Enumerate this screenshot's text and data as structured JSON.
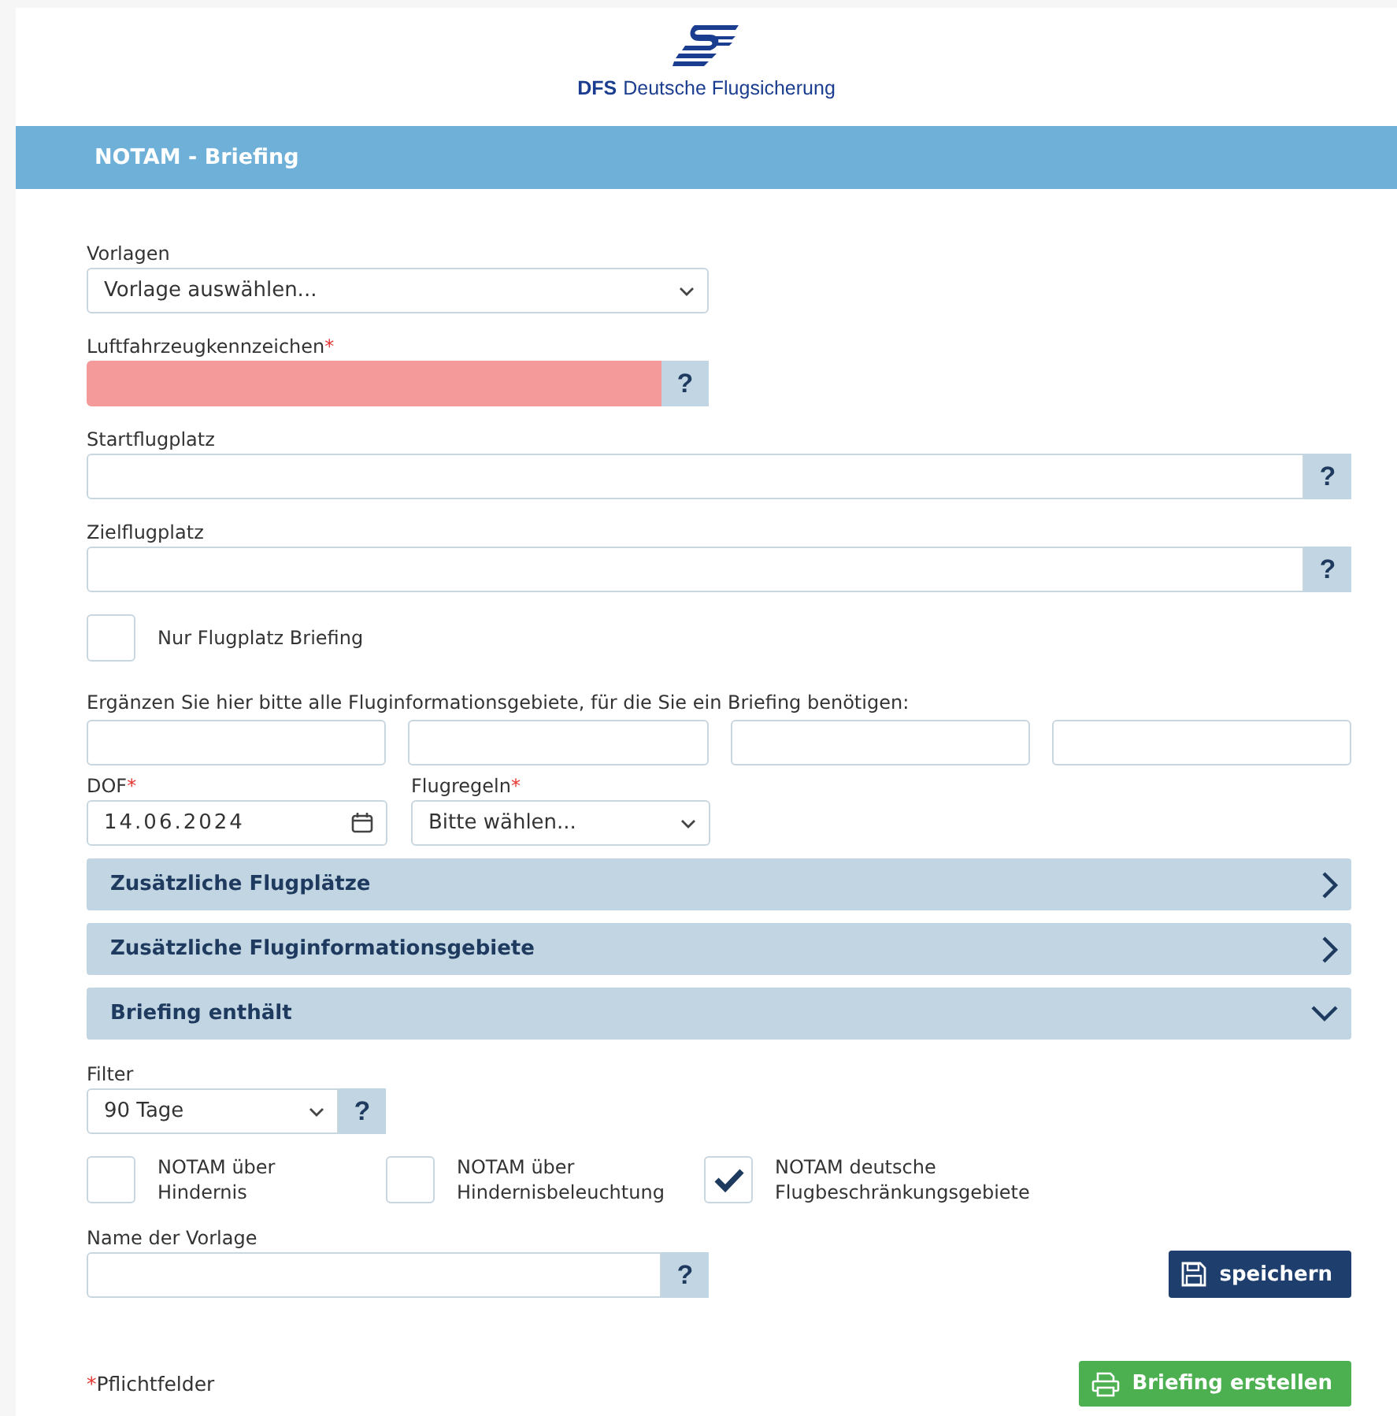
{
  "header": {
    "logo_abbr": "DFS",
    "logo_name": "Deutsche Flugsicherung"
  },
  "title_bar": "NOTAM - Briefing",
  "required_mark": "*",
  "template_select": {
    "label": "Vorlagen",
    "value": "Vorlage auswählen..."
  },
  "registration": {
    "label": "Luftfahrzeugkennzeichen",
    "required": true,
    "invalid": true,
    "help": "?"
  },
  "departure": {
    "label": "Startflugplatz",
    "required": false,
    "invalid": false,
    "help": "?"
  },
  "destination": {
    "label": "Zielflugplatz",
    "required": false,
    "invalid": false,
    "help": "?"
  },
  "aerodrome_only": {
    "label": "Nur Flugplatz Briefing",
    "checked": false
  },
  "fir": {
    "label": "Ergänzen Sie hier bitte alle Fluginformationsgebiete, für die Sie ein Briefing benötigen:"
  },
  "dof": {
    "label": "DOF",
    "required": true,
    "value": "14.06.2024"
  },
  "flight_rules": {
    "label": "Flugregeln",
    "required": true,
    "value": "Bitte wählen..."
  },
  "sections": [
    {
      "title": "Zusätzliche Flugplätze",
      "expanded": false
    },
    {
      "title": "Zusätzliche Fluginformationsgebiete",
      "expanded": false
    },
    {
      "title": "Briefing enthält",
      "expanded": true
    }
  ],
  "filter": {
    "label": "Filter",
    "value": "90 Tage",
    "help": "?"
  },
  "options": [
    {
      "label": "NOTAM über\nHindernis",
      "checked": false
    },
    {
      "label": "NOTAM über\nHindernisbeleuchtung",
      "checked": false
    },
    {
      "label": "NOTAM deutsche\nFlugbeschränkungsgebiete",
      "checked": true
    }
  ],
  "template_name": {
    "label": "Name der Vorlage",
    "help": "?"
  },
  "save_button": "speichern",
  "required_note": "Pflichtfelder",
  "create_button": "Briefing erstellen"
}
